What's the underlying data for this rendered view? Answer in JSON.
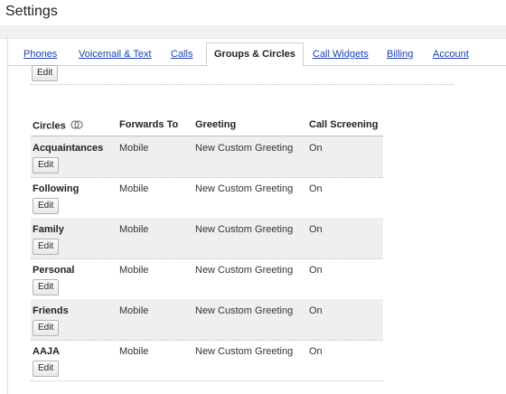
{
  "page": {
    "title": "Settings"
  },
  "tabs": [
    {
      "label": "Phones"
    },
    {
      "label": "Voicemail & Text"
    },
    {
      "label": "Calls"
    },
    {
      "label": "Groups & Circles"
    },
    {
      "label": "Call Widgets"
    },
    {
      "label": "Billing"
    },
    {
      "label": "Account"
    }
  ],
  "active_tab": "Groups & Circles",
  "top_edit_label": "Edit",
  "table": {
    "headers": {
      "circles": "Circles",
      "forwards_to": "Forwards To",
      "greeting": "Greeting",
      "call_screening": "Call Screening"
    },
    "circles_header_icon": "circles-icon",
    "rows": [
      {
        "name": "Acquaintances",
        "forwards_to": "Mobile",
        "greeting": "New Custom Greeting",
        "call_screening": "On",
        "edit_label": "Edit"
      },
      {
        "name": "Following",
        "forwards_to": "Mobile",
        "greeting": "New Custom Greeting",
        "call_screening": "On",
        "edit_label": "Edit"
      },
      {
        "name": "Family",
        "forwards_to": "Mobile",
        "greeting": "New Custom Greeting",
        "call_screening": "On",
        "edit_label": "Edit"
      },
      {
        "name": "Personal",
        "forwards_to": "Mobile",
        "greeting": "New Custom Greeting",
        "call_screening": "On",
        "edit_label": "Edit"
      },
      {
        "name": "Friends",
        "forwards_to": "Mobile",
        "greeting": "New Custom Greeting",
        "call_screening": "On",
        "edit_label": "Edit"
      },
      {
        "name": "AAJA",
        "forwards_to": "Mobile",
        "greeting": "New Custom Greeting",
        "call_screening": "On",
        "edit_label": "Edit"
      }
    ]
  },
  "colors": {
    "link": "#1a3fb5",
    "row_shade": "#efefef",
    "border": "#cfcfcf"
  }
}
